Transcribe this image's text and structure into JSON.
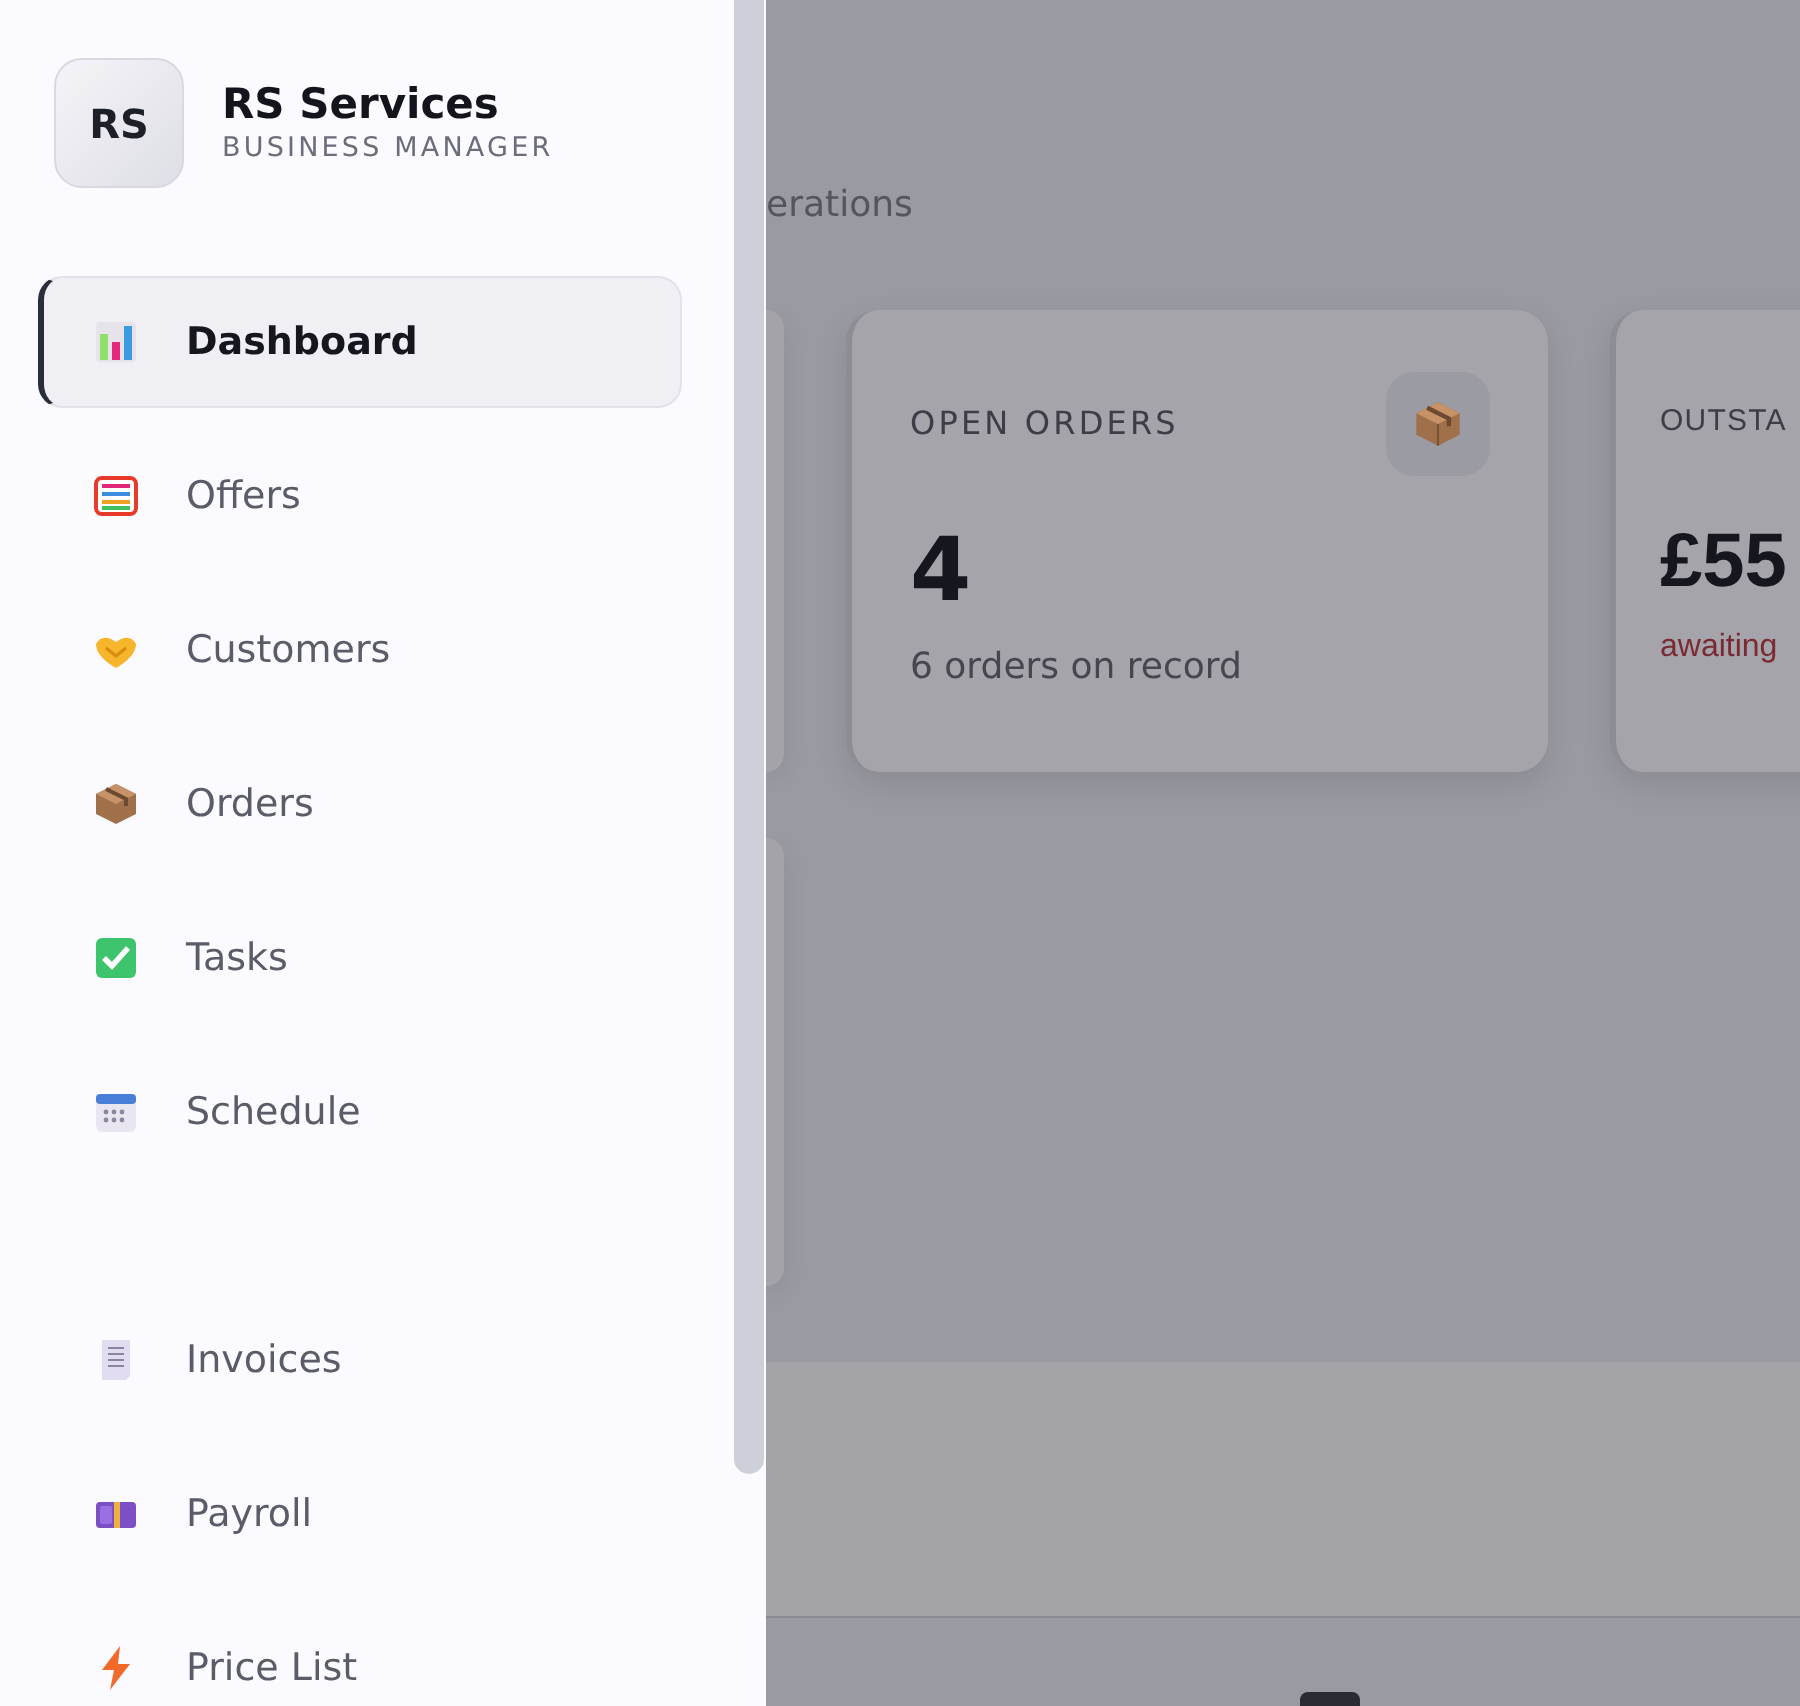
{
  "sidebar": {
    "logo": "RS",
    "title": "RS Services",
    "subtitle": "BUSINESS MANAGER",
    "sections": [
      {
        "items": [
          {
            "label": "Dashboard",
            "selected": true
          },
          {
            "label": "Offers",
            "selected": false
          },
          {
            "label": "Customers",
            "selected": false
          },
          {
            "label": "Orders",
            "selected": false
          },
          {
            "label": "Tasks",
            "selected": false
          },
          {
            "label": "Schedule",
            "selected": false
          }
        ]
      },
      {
        "items": [
          {
            "label": "Invoices",
            "selected": false
          },
          {
            "label": "Payroll",
            "selected": false
          },
          {
            "label": "Price List",
            "selected": false
          }
        ]
      }
    ]
  },
  "main": {
    "subtitle": "erations",
    "cards": [
      {
        "kind": "count",
        "label": "OPEN ORDERS",
        "value": "4",
        "note": "6 orders on record"
      },
      {
        "kind": "money",
        "label": "OUTSTA",
        "value": "£55",
        "note": "awaiting"
      }
    ]
  }
}
